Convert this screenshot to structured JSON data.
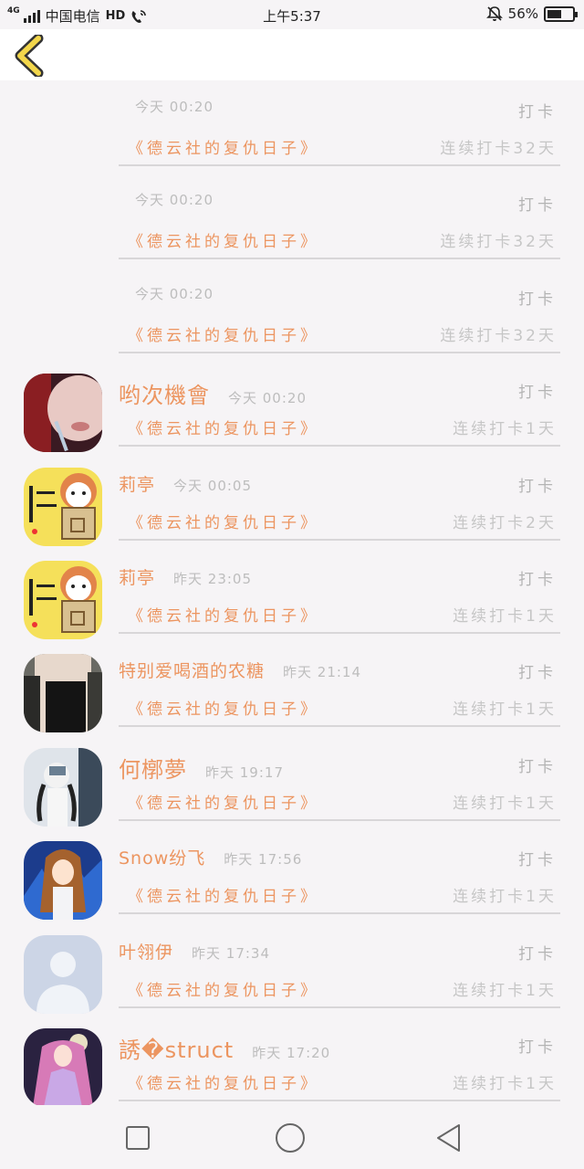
{
  "status_bar": {
    "network": "4G",
    "carrier": "中国电信",
    "hd": "HD",
    "time": "上午5:37",
    "battery_percent": "56%",
    "battery_level": 0.56
  },
  "header": {
    "back_icon": "chevron-left-icon",
    "accent": "#f2d64b"
  },
  "entries": [
    {
      "name": "",
      "time": "今天 00:20",
      "checkin": "打卡",
      "book": "《德云社的复仇日子》",
      "streak": "连续打卡32天",
      "avatar": "none"
    },
    {
      "name": "",
      "time": "今天 00:20",
      "checkin": "打卡",
      "book": "《德云社的复仇日子》",
      "streak": "连续打卡32天",
      "avatar": "none"
    },
    {
      "name": "",
      "time": "今天 00:20",
      "checkin": "打卡",
      "book": "《德云社的复仇日子》",
      "streak": "连续打卡32天",
      "avatar": "none"
    },
    {
      "name": "哟次機會",
      "time": "今天 00:20",
      "checkin": "打卡",
      "book": "《德云社的复仇日子》",
      "streak": "连续打卡1天",
      "avatar": "photo-dark"
    },
    {
      "name": "莉亭",
      "time": "今天 00:05",
      "checkin": "打卡",
      "book": "《德云社的复仇日子》",
      "streak": "连续打卡2天",
      "avatar": "cartoon-cat"
    },
    {
      "name": "莉亭",
      "time": "昨天 23:05",
      "checkin": "打卡",
      "book": "《德云社的复仇日子》",
      "streak": "连续打卡1天",
      "avatar": "cartoon-cat"
    },
    {
      "name": "特别爱喝酒的农糖",
      "time": "昨天 21:14",
      "checkin": "打卡",
      "book": "《德云社的复仇日子》",
      "streak": "连续打卡1天",
      "avatar": "photo-person"
    },
    {
      "name": "何槨夢",
      "time": "昨天 19:17",
      "checkin": "打卡",
      "book": "《德云社的复仇日子》",
      "streak": "连续打卡1天",
      "avatar": "photo-mirror"
    },
    {
      "name": "Snow纷飞",
      "time": "昨天 17:56",
      "checkin": "打卡",
      "book": "《德云社的复仇日子》",
      "streak": "连续打卡1天",
      "avatar": "anime-girl"
    },
    {
      "name": "叶翎伊",
      "time": "昨天 17:34",
      "checkin": "打卡",
      "book": "《德云社的复仇日子》",
      "streak": "连续打卡1天",
      "avatar": "default-person"
    },
    {
      "name": "誘�struct",
      "time": "昨天 17:20",
      "checkin": "打卡",
      "book": "《德云社的复仇日子》",
      "streak": "连续打卡1天",
      "avatar": "anime-purple"
    }
  ],
  "nav": {
    "recent": "square-icon",
    "home": "circle-icon",
    "back": "triangle-back-icon"
  }
}
